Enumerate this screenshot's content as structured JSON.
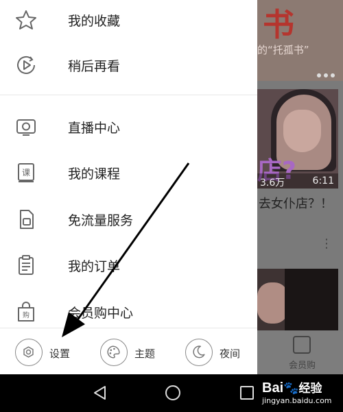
{
  "drawer": {
    "items": [
      {
        "label": "我的收藏",
        "icon": "star-icon"
      },
      {
        "label": "稍后再看",
        "icon": "watch-later-icon"
      },
      {
        "label": "直播中心",
        "icon": "live-tv-icon"
      },
      {
        "label": "我的课程",
        "icon": "course-book-icon"
      },
      {
        "label": "免流量服务",
        "icon": "sim-card-icon"
      },
      {
        "label": "我的订单",
        "icon": "order-clipboard-icon"
      },
      {
        "label": "会员购中心",
        "icon": "shopping-bag-icon"
      }
    ],
    "course_icon_char": "课",
    "bag_icon_char": "购",
    "footer": [
      {
        "label": "设置",
        "icon": "settings-gear-icon"
      },
      {
        "label": "主题",
        "icon": "theme-palette-icon"
      },
      {
        "label": "夜间",
        "icon": "night-moon-icon"
      }
    ]
  },
  "background": {
    "banner_title": "书",
    "banner_subtitle": "的“托孤书”",
    "video_views": "3.6万",
    "video_duration": "6:11",
    "video_title": "去女仆店？！",
    "video_overlay_text": "店?",
    "more_icon": "more-vertical-icon",
    "bottom_nav_label": "会员购"
  },
  "watermark": {
    "brand": "Bai",
    "brand_suffix": "经验",
    "url": "jingyan.baidu.com"
  },
  "colors": {
    "drawer_bg": "#ffffff",
    "scrim": "#6f6f6f",
    "arrow": "#000000"
  }
}
